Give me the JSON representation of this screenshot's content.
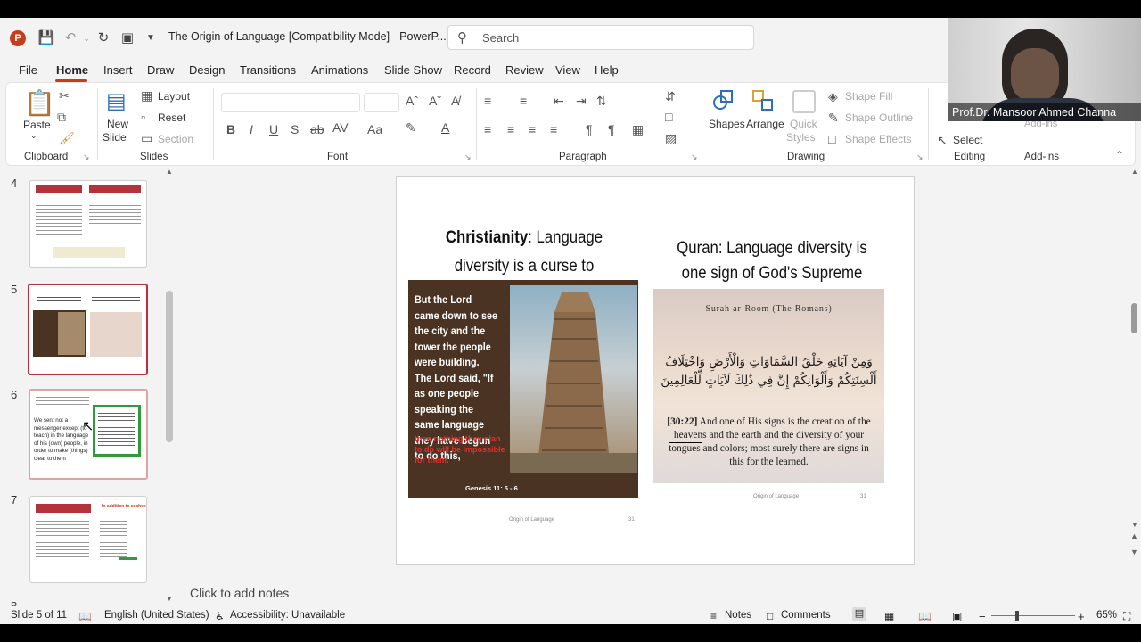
{
  "app": {
    "doc_title": "The Origin of Language [Compatibility Mode]  -  PowerP...",
    "search_placeholder": "Search"
  },
  "menu": [
    "File",
    "Home",
    "Insert",
    "Draw",
    "Design",
    "Transitions",
    "Animations",
    "Slide Show",
    "Record",
    "Review",
    "View",
    "Help"
  ],
  "ribbon": {
    "clipboard": {
      "paste": "Paste",
      "label": "Clipboard"
    },
    "slides": {
      "new_slide_1": "New",
      "new_slide_2": "Slide",
      "layout": "Layout",
      "reset": "Reset",
      "section": "Section",
      "label": "Slides"
    },
    "font": {
      "label": "Font",
      "bold": "B",
      "italic": "I",
      "underline": "U",
      "strike": "S"
    },
    "paragraph": {
      "label": "Paragraph"
    },
    "drawing": {
      "shapes": "Shapes",
      "arrange": "Arrange",
      "quick_1": "Quick",
      "quick_2": "Styles",
      "shape_fill": "Shape Fill",
      "shape_outline": "Shape Outline",
      "shape_effects": "Shape Effects",
      "label": "Drawing"
    },
    "editing": {
      "select": "Select",
      "label": "Editing"
    },
    "addins": {
      "label": "Add-ins",
      "partial": "Add-ins"
    }
  },
  "webcam": {
    "name": "Prof.Dr. Mansoor Ahmed Channa"
  },
  "thumbnails": [
    {
      "num": "4"
    },
    {
      "num": "5"
    },
    {
      "num": "6",
      "text": "We sent not a messenger except (to teach) in the language of his (own) people, in order to make (things) clear to them"
    },
    {
      "num": "7",
      "right_title": "In addition to caches"
    },
    {
      "num": "8"
    }
  ],
  "slide": {
    "left_title_bold": "Christianity",
    "left_title_rest": ": Language diversity is a curse to humanity!",
    "babel_text": "But the Lord came down to see the city and the tower the people were building. The Lord said, \"If as one people speaking the same language they have begun to do this,",
    "babel_red": "then nothing they plan to do will be impossible for them.",
    "babel_ref": "Genesis 11: 5 - 6",
    "right_title": "Quran: Language diversity is one sign of God's Supreme Power",
    "surah": "Surah ar-Room (The Romans)",
    "arabic": "وَمِنْ آيَاتِهِ خَلْقُ السَّمَاوَاتِ وَالْأَرْضِ وَاخْتِلَافُ أَلْسِنَتِكُمْ وَأَلْوَانِكُمْ إِنَّ فِي ذَٰلِكَ لَآيَاتٍ لِّلْعَالِمِينَ",
    "verse_ref": "[30:22]",
    "translation": " And one of His signs is the creation of the heavens and the earth and the diversity of your tongues and colors; most surely there are signs in this for the learned.",
    "footer_left": "Origin of Language",
    "footer_num_left": "31",
    "footer_right": "Origin of Language",
    "footer_num_right": "31"
  },
  "notes_placeholder": "Click to add notes",
  "status": {
    "slide": "Slide 5 of 11",
    "language": "English (United States)",
    "accessibility": "Accessibility: Unavailable",
    "notes": "Notes",
    "comments": "Comments",
    "zoom": "65%"
  },
  "colors": {
    "accent": "#c43e1c",
    "selected_thumb": "#b4333a"
  }
}
